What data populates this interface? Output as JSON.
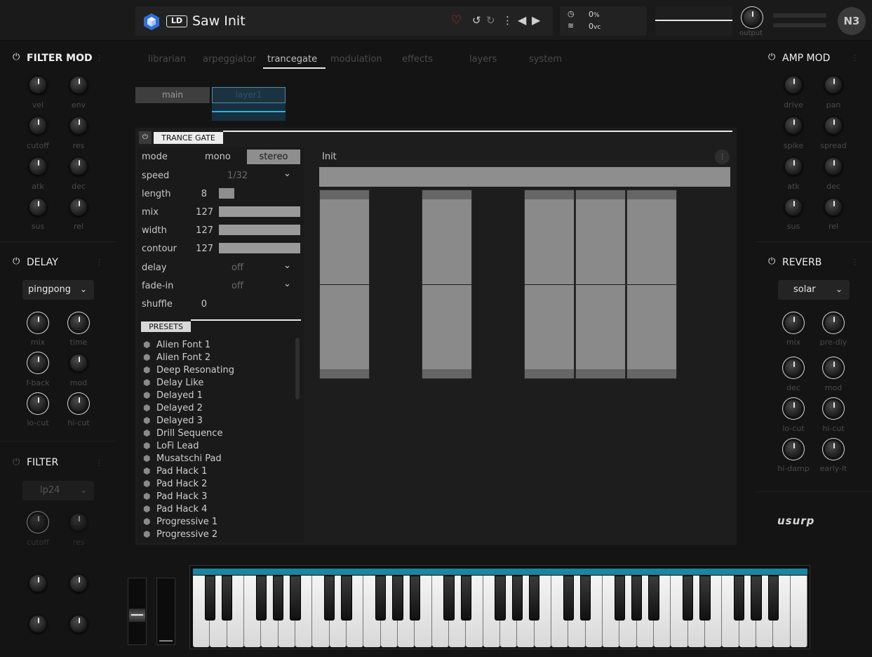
{
  "header": {
    "badge": "LD",
    "preset_name": "Saw Init",
    "cpu_value": "0",
    "cpu_unit": "%",
    "voices_value": "0",
    "voices_unit": "vc",
    "output_label": "output",
    "brand_logo": "N3"
  },
  "tabs": [
    "librarian",
    "arpeggiator",
    "trancegate",
    "modulation",
    "effects",
    "layers",
    "system"
  ],
  "active_tab": "trancegate",
  "layer_buttons": {
    "main": "main",
    "layer1": "layer1"
  },
  "filter_mod": {
    "title": "FILTER MOD",
    "knobs": [
      "vel",
      "env",
      "cutoff",
      "res",
      "atk",
      "dec",
      "sus",
      "rel"
    ]
  },
  "delay": {
    "title": "DELAY",
    "mode": "pingpong",
    "knobs": [
      "mix",
      "time",
      "f-back",
      "mod",
      "lo-cut",
      "hi-cut"
    ]
  },
  "filter": {
    "title": "FILTER",
    "type": "lp24",
    "knobs": [
      "cutoff",
      "res"
    ]
  },
  "amp_mod": {
    "title": "AMP MOD",
    "knobs": [
      "drive",
      "pan",
      "spike",
      "spread",
      "atk",
      "dec",
      "sus",
      "rel"
    ]
  },
  "reverb": {
    "title": "REVERB",
    "mode": "solar",
    "knobs": [
      "mix",
      "pre-dly",
      "dec",
      "mod",
      "lo-cut",
      "hi-cut",
      "hi-damp",
      "early-lt"
    ]
  },
  "trance_gate": {
    "title": "TRANCE GATE",
    "mode_label": "mode",
    "mode_mono": "mono",
    "mode_stereo": "stereo",
    "speed_label": "speed",
    "speed_value": "1/32",
    "length_label": "length",
    "length_value": "8",
    "mix_label": "mix",
    "mix_value": "127",
    "width_label": "width",
    "width_value": "127",
    "contour_label": "contour",
    "contour_value": "127",
    "delay_label": "delay",
    "delay_value": "off",
    "fadein_label": "fade-in",
    "fadein_value": "off",
    "shuffle_label": "shuffle",
    "shuffle_value": "0",
    "presets_label": "PRESETS",
    "pattern_name": "Init",
    "presets": [
      "Alien Font 1",
      "Alien Font 2",
      "Deep Resonating",
      "Delay Like",
      "Delayed 1",
      "Delayed 2",
      "Delayed 3",
      "Drill Sequence",
      "LoFi Lead",
      "Musatschi Pad",
      "Pad Hack 1",
      "Pad Hack 2",
      "Pad Hack 3",
      "Pad Hack 4",
      "Progressive 1",
      "Progressive 2"
    ],
    "steps_active": [
      true,
      false,
      true,
      false,
      true,
      true,
      true,
      false
    ]
  },
  "brand": "usurp",
  "colors": {
    "accent": "#1a86a2",
    "heart": "#e0302f",
    "background": "#141414"
  }
}
